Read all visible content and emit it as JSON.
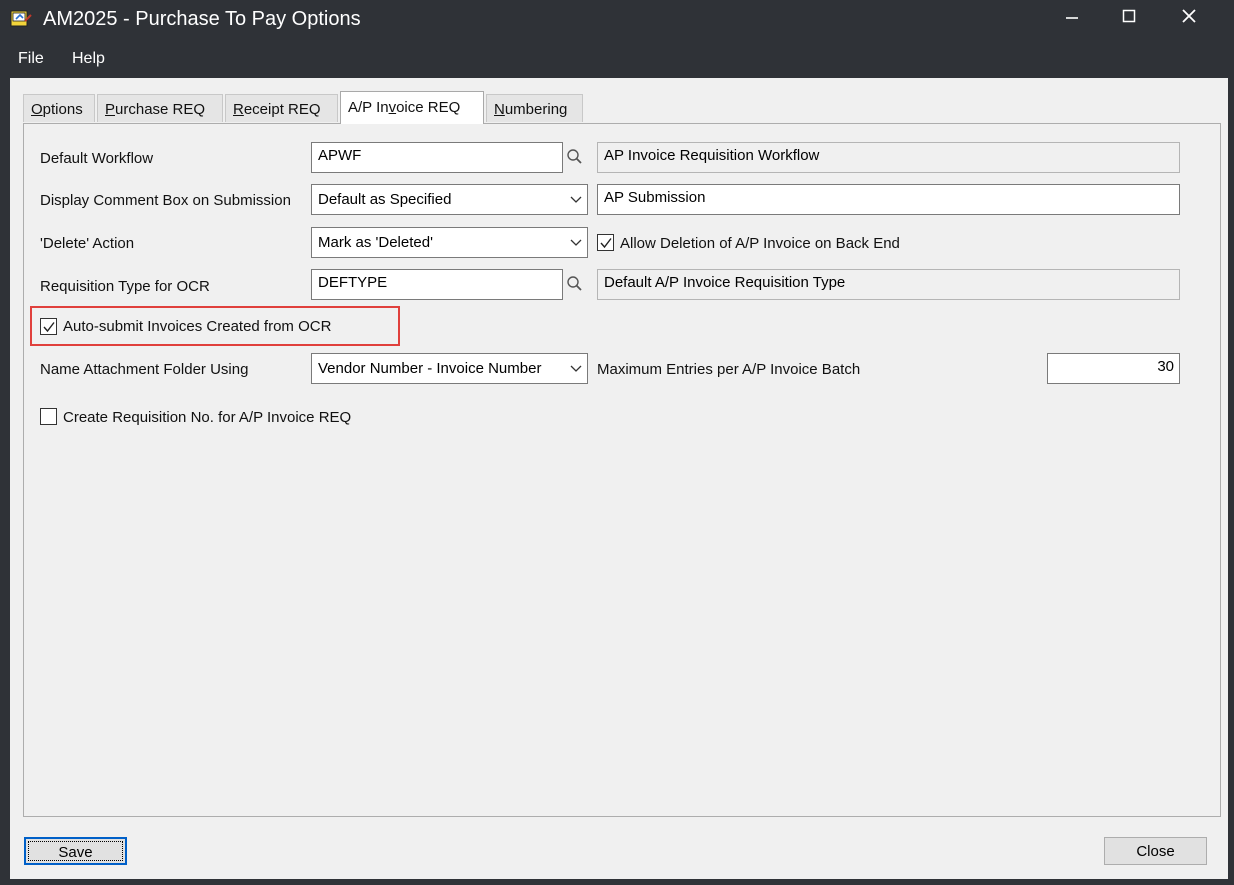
{
  "window": {
    "title": "AM2025 - Purchase To Pay Options",
    "controls": {
      "minimize_icon": "minimize-icon",
      "maximize_icon": "maximize-icon",
      "close_icon": "close-icon"
    }
  },
  "menu": {
    "file": "File",
    "help": "Help"
  },
  "tabs": [
    {
      "pre": "",
      "u": "O",
      "post": "ptions",
      "active": false
    },
    {
      "pre": "",
      "u": "P",
      "post": "urchase REQ",
      "active": false
    },
    {
      "pre": "",
      "u": "R",
      "post": "eceipt REQ",
      "active": false
    },
    {
      "pre": "A/P In",
      "u": "v",
      "post": "oice REQ",
      "active": true
    },
    {
      "pre": "",
      "u": "N",
      "post": "umbering",
      "active": false
    }
  ],
  "form": {
    "default_workflow": {
      "label": "Default Workflow",
      "value": "APWF",
      "description": "AP Invoice Requisition Workflow"
    },
    "comment_box": {
      "label": "Display Comment Box on Submission",
      "value": "Default as Specified",
      "text": "AP Submission"
    },
    "delete_action": {
      "label": "'Delete' Action",
      "value": "Mark as 'Deleted'",
      "checkbox_label": "Allow Deletion of A/P Invoice on Back End",
      "checked": true
    },
    "req_type_ocr": {
      "label": "Requisition Type for OCR",
      "value": "DEFTYPE",
      "description": "Default A/P Invoice Requisition Type"
    },
    "auto_submit": {
      "label": "Auto-submit Invoices Created from OCR",
      "checked": true
    },
    "attachment_folder": {
      "label": "Name Attachment Folder Using",
      "value": "Vendor Number - Invoice Number"
    },
    "max_entries": {
      "label": "Maximum Entries per A/P Invoice Batch",
      "value": "30"
    },
    "create_req_no": {
      "label": "Create Requisition No. for A/P Invoice REQ",
      "checked": false
    }
  },
  "buttons": {
    "save": "Save",
    "close": "Close"
  },
  "colors": {
    "titlebar": "#2f3237",
    "highlight": "#e0403c",
    "focus": "#0060c8"
  }
}
